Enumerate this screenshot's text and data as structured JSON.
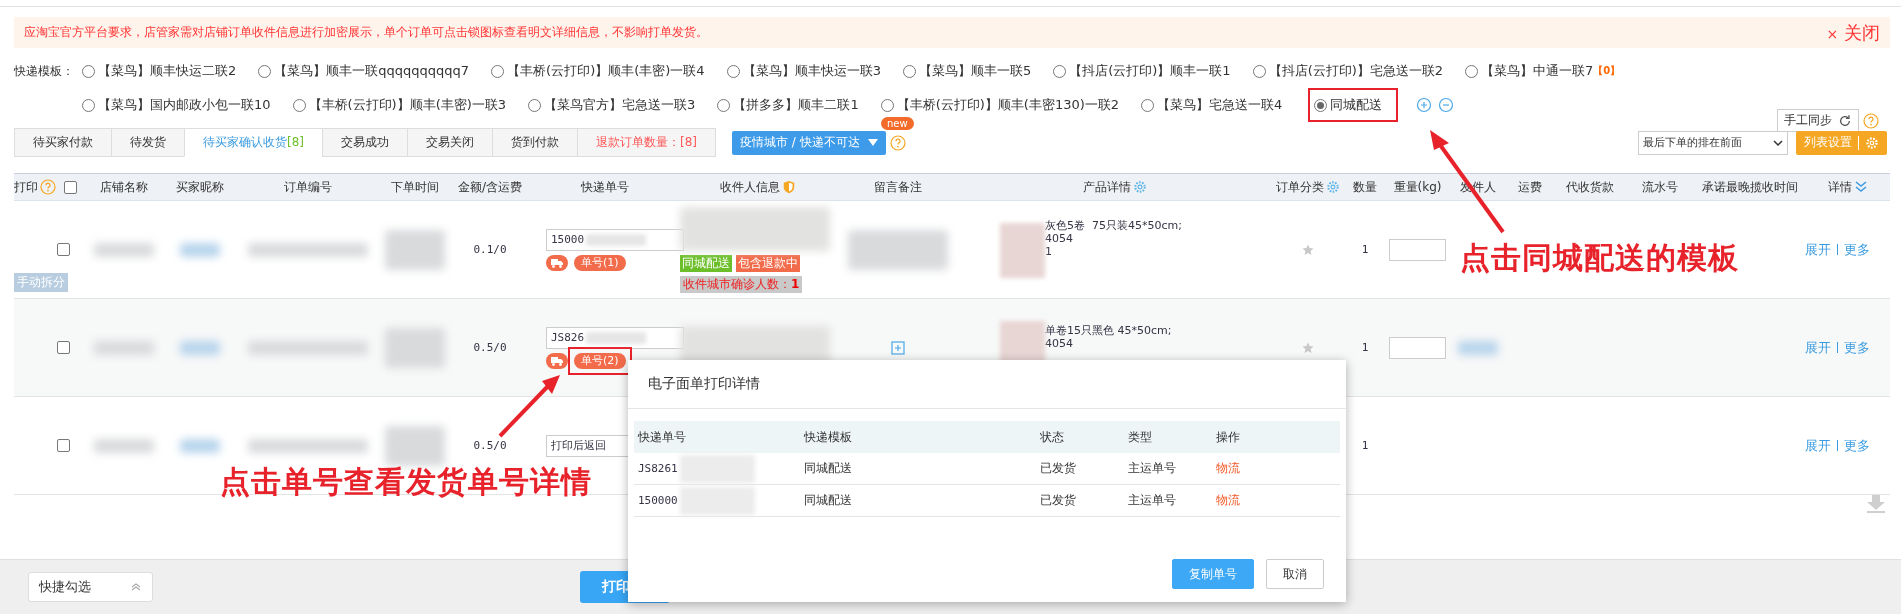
{
  "banner": {
    "text": "应淘宝官方平台要求，店管家需对店铺订单收件信息进行加密展示，单个订单可点击锁图标查看明文详细信息，不影响打单发货。",
    "close_icon": "×",
    "close_label": "关闭"
  },
  "templates": {
    "label": "快递模板：",
    "rows": [
      [
        {
          "name": "【菜鸟】顺丰快运二联2",
          "selected": false,
          "highlighted": false
        },
        {
          "name": "【菜鸟】顺丰一联qqqqqqqqqq7",
          "selected": false,
          "highlighted": false
        },
        {
          "name": "【丰桥(云打印)】顺丰(丰密)一联4",
          "selected": false,
          "highlighted": false
        },
        {
          "name": "【菜鸟】顺丰快运一联3",
          "selected": false,
          "highlighted": false
        },
        {
          "name": "【菜鸟】顺丰一联5",
          "selected": false,
          "highlighted": false
        },
        {
          "name": "【抖店(云打印)】顺丰一联1",
          "selected": false,
          "highlighted": false
        },
        {
          "name": "【抖店(云打印)】宅急送一联2",
          "selected": false,
          "highlighted": false
        },
        {
          "name": "【菜鸟】中通一联7",
          "count": "【0】",
          "selected": false,
          "highlighted": false
        }
      ],
      [
        {
          "name": "【菜鸟】国内邮政小包一联10",
          "selected": false,
          "highlighted": false
        },
        {
          "name": "【丰桥(云打印)】顺丰(丰密)一联3",
          "selected": false,
          "highlighted": false
        },
        {
          "name": "【菜鸟官方】宅急送一联3",
          "selected": false,
          "highlighted": false
        },
        {
          "name": "【拼多多】顺丰二联1",
          "selected": false,
          "highlighted": false
        },
        {
          "name": "【丰桥(云打印)】顺丰(丰密130)一联2",
          "selected": false,
          "highlighted": false
        },
        {
          "name": "【菜鸟】宅急送一联4",
          "selected": false,
          "highlighted": false
        },
        {
          "name": "同城配送",
          "selected": true,
          "highlighted": true
        }
      ]
    ]
  },
  "sync_button": "手工同步",
  "tabs": [
    {
      "label": "待买家付款",
      "kind": "normal",
      "selected": false
    },
    {
      "label": "待发货",
      "kind": "normal",
      "selected": false
    },
    {
      "label": "待买家确认收货",
      "count": "[8]",
      "kind": "normal",
      "selected": true
    },
    {
      "label": "交易成功",
      "kind": "normal",
      "selected": false
    },
    {
      "label": "交易关闭",
      "kind": "normal",
      "selected": false
    },
    {
      "label": "货到付款",
      "kind": "normal",
      "selected": false
    },
    {
      "label": "退款订单数量：",
      "count": "[8]",
      "kind": "refund",
      "selected": false
    }
  ],
  "epidemic_button": {
    "label": "疫情城市 / 快递不可达",
    "badge": "new"
  },
  "sort_select": "最后下单的排在前面",
  "list_settings": "列表设置",
  "table": {
    "select_all_checked": false,
    "columns": [
      "打印",
      "店铺名称",
      "买家昵称",
      "订单编号",
      "下单时间",
      "金额/含运费",
      "快递单号",
      "收件人信息",
      "留言备注",
      "产品详情",
      "订单分类",
      "数量",
      "重量(kg)",
      "发件人",
      "运费",
      "代收货款",
      "流水号",
      "承诺最晚揽收时间",
      "详情"
    ],
    "rows": [
      {
        "checked": false,
        "split_tag": "手动拆分",
        "amount": "0.1/0",
        "tracking": "15000",
        "waybill": "单号(1)",
        "waybill_highlighted": false,
        "recipient_tags": [
          {
            "text": "同城配送",
            "color": "#6cbf2a"
          },
          {
            "text": "包含退款中",
            "color": "#f26b4a"
          }
        ],
        "cases": {
          "label": "收件城市确诊人数：",
          "count": "1"
        },
        "has_note": false,
        "product_lines": [
          "灰色5卷  75只装45*50cm;",
          "4054",
          "1"
        ],
        "quantity": "1",
        "actions": [
          "展开",
          "更多"
        ]
      },
      {
        "checked": false,
        "amount": "0.5/0",
        "tracking": "JS826",
        "waybill": "单号(2)",
        "waybill_highlighted": true,
        "recipient_tags": [],
        "has_note": true,
        "product_lines": [
          "单卷15只黑色 45*50cm;",
          "4054"
        ],
        "quantity": "1",
        "actions": [
          "展开",
          "更多"
        ]
      },
      {
        "checked": false,
        "amount": "0.5/0",
        "tracking": "打印后返回",
        "recipient_tags": [],
        "product_lines": [],
        "quantity": "1",
        "actions": [
          "展开",
          "更多"
        ]
      }
    ]
  },
  "annotations": [
    {
      "text": "点击同城配送的模板"
    },
    {
      "text": "点击单号查看发货单号详情"
    }
  ],
  "dialog": {
    "title": "电子面单打印详情",
    "columns": [
      "快递单号",
      "快递模板",
      "状态",
      "类型",
      "操作"
    ],
    "rows": [
      {
        "tracking": "JS8261",
        "template": "同城配送",
        "status": "已发货",
        "type": "主运单号",
        "action": "物流"
      },
      {
        "tracking": "150000",
        "template": "同城配送",
        "status": "已发货",
        "type": "主运单号",
        "action": "物流"
      }
    ],
    "buttons": [
      {
        "label": "复制单号",
        "kind": "primary"
      },
      {
        "label": "取消",
        "kind": "default"
      }
    ]
  },
  "footer": {
    "quick_select": "快捷勾选",
    "print_button": "打印"
  }
}
